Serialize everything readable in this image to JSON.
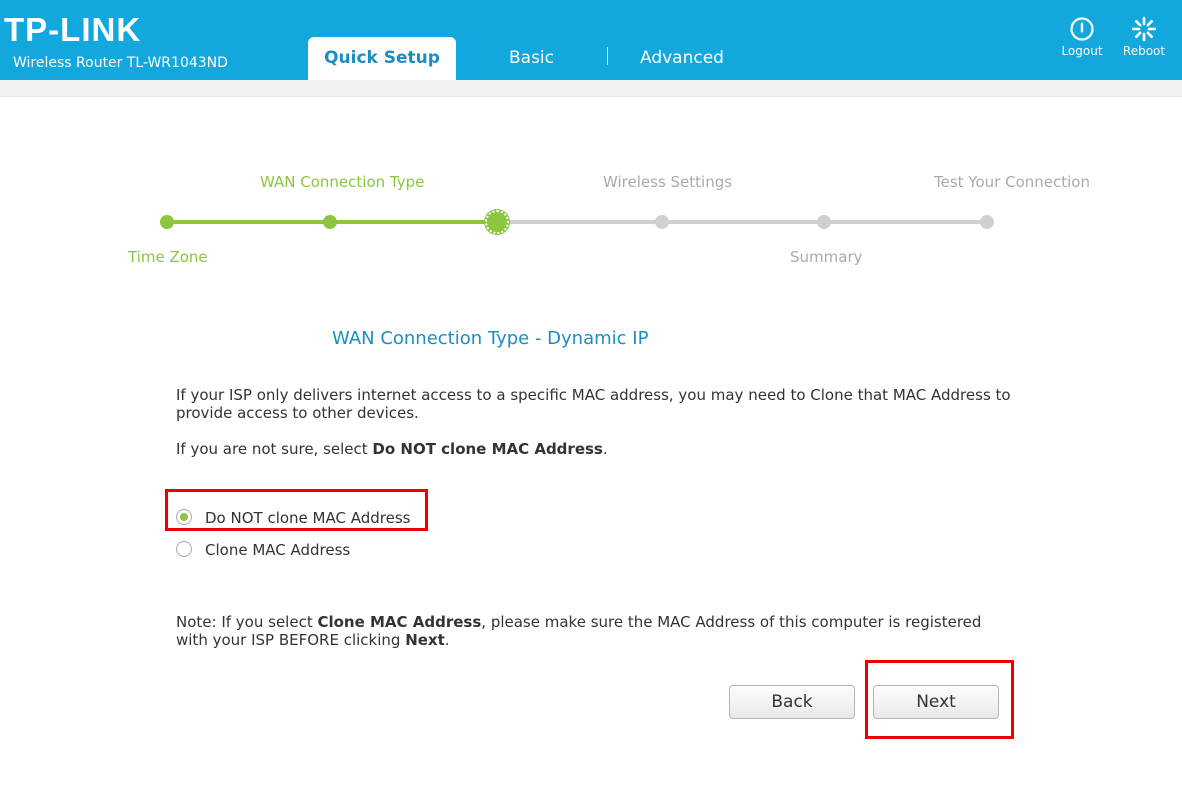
{
  "header": {
    "logo": "TP-LINK",
    "model": "Wireless Router TL-WR1043ND",
    "tabs": [
      {
        "label": "Quick Setup",
        "active": true
      },
      {
        "label": "Basic"
      },
      {
        "label": "Advanced"
      }
    ],
    "logout_label": "Logout",
    "reboot_label": "Reboot",
    "logout_icon": "power-icon",
    "reboot_icon": "reboot-icon"
  },
  "steps": {
    "upper": [
      "WAN Connection Type",
      "Wireless Settings",
      "Test Your Connection"
    ],
    "lower": [
      "Time Zone",
      "Summary"
    ],
    "total": 6,
    "current_index": 2
  },
  "content": {
    "title": "WAN Connection Type - Dynamic IP",
    "p1": "If your ISP only delivers internet access to a specific MAC address, you may need to Clone that MAC Address to provide access to other devices.",
    "p2_prefix": "If you are not sure, select ",
    "p2_bold": "Do NOT clone MAC Address",
    "p2_suffix": ".",
    "options": [
      {
        "label": "Do NOT clone MAC Address",
        "selected": true
      },
      {
        "label": "Clone MAC Address",
        "selected": false
      }
    ],
    "note_prefix": "Note: If you select ",
    "note_bold1": "Clone MAC Address",
    "note_mid": ", please make sure the MAC Address of this computer is registered with your ISP BEFORE clicking ",
    "note_bold2": "Next",
    "note_suffix": "."
  },
  "buttons": {
    "back": "Back",
    "next": "Next"
  },
  "colors": {
    "header": "#12a8de",
    "done": "#8cc63f",
    "todo": "#d0d0d0",
    "title": "#1a8fbf",
    "highlight": "#ee0000"
  }
}
